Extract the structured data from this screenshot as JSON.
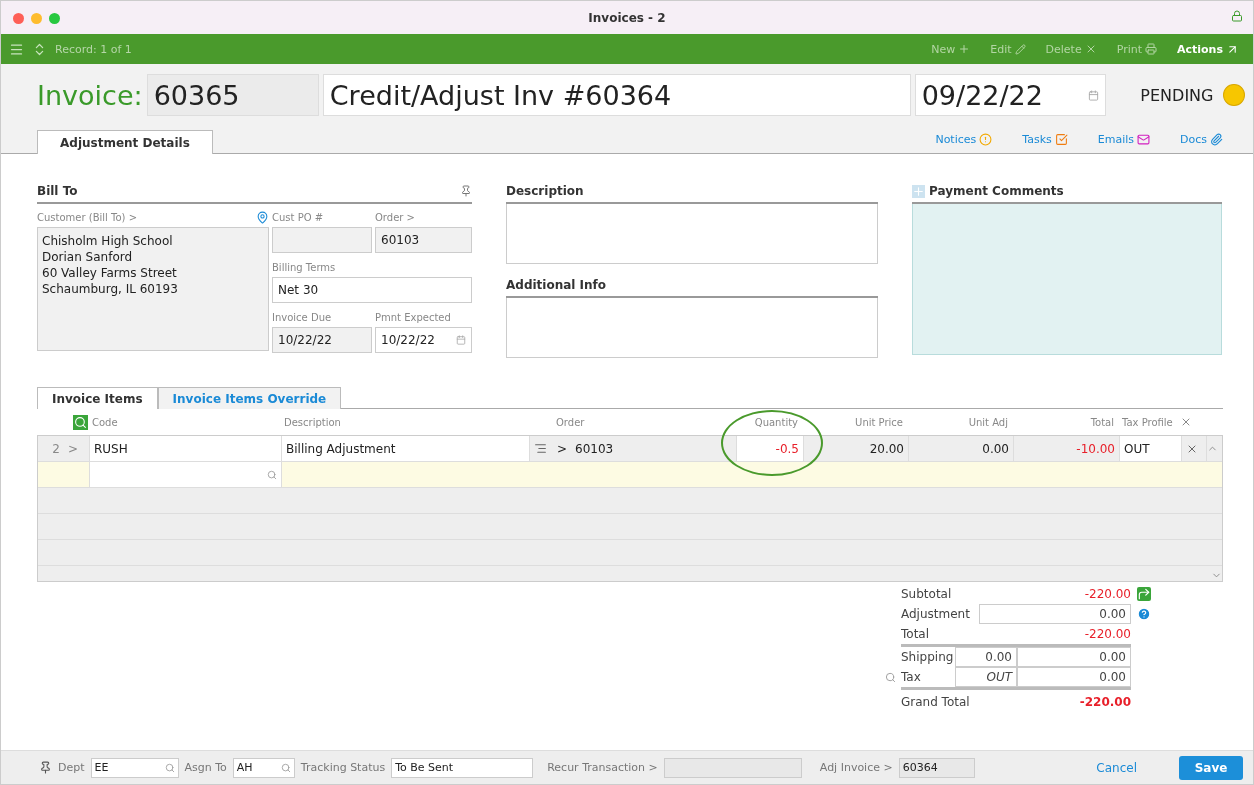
{
  "window": {
    "title": "Invoices - 2"
  },
  "toolbar": {
    "record": "Record: 1 of 1",
    "actions": [
      {
        "kind": "new",
        "label": "New",
        "disabled": true
      },
      {
        "kind": "edit",
        "label": "Edit",
        "disabled": true
      },
      {
        "kind": "delete",
        "label": "Delete",
        "disabled": true
      },
      {
        "kind": "print",
        "label": "Print",
        "disabled": true
      },
      {
        "kind": "actions",
        "label": "Actions",
        "disabled": false
      }
    ]
  },
  "header": {
    "label": "Invoice:",
    "number": "60365",
    "description": "Credit/Adjust Inv #60364",
    "date": "09/22/22",
    "status": "PENDING"
  },
  "tabs": [
    {
      "label": "Adjustment Details",
      "selected": true
    }
  ],
  "links": [
    {
      "kind": "notices",
      "label": "Notices"
    },
    {
      "kind": "tasks",
      "label": "Tasks"
    },
    {
      "kind": "emails",
      "label": "Emails"
    },
    {
      "kind": "docs",
      "label": "Docs"
    }
  ],
  "bill_to": {
    "heading": "Bill To",
    "customer_label": "Customer (Bill To) >",
    "address": [
      "Chisholm High School",
      "Dorian Sanford",
      "60 Valley Farms Street",
      "Schaumburg, IL 60193"
    ],
    "cust_po_label": "Cust PO #",
    "order_label": "Order >",
    "order": "60103",
    "billing_terms_label": "Billing Terms",
    "billing_terms": "Net 30",
    "invoice_due_label": "Invoice Due",
    "invoice_due": "10/22/22",
    "pmnt_expected_label": "Pmnt Expected",
    "pmnt_expected": "10/22/22"
  },
  "description": {
    "heading": "Description"
  },
  "additional_info": {
    "heading": "Additional Info"
  },
  "payment_comments": {
    "heading": "Payment Comments"
  },
  "item_tabs": [
    {
      "label": "Invoice Items",
      "selected": true
    },
    {
      "label": "Invoice Items Override",
      "selected": false
    }
  ],
  "table": {
    "columns": [
      {
        "label": "Code",
        "circled": false
      },
      {
        "label": "Description",
        "circled": false
      },
      {
        "label": "Order",
        "circled": false
      },
      {
        "label": "Quantity",
        "circled": true
      },
      {
        "label": "Unit Price",
        "circled": false
      },
      {
        "label": "Unit Adj",
        "circled": false
      },
      {
        "label": "Total",
        "circled": false
      },
      {
        "label": "Tax Profile",
        "circled": false
      }
    ],
    "rows": [
      {
        "line": "2",
        "arrow": ">",
        "code": "RUSH",
        "description": "Billing Adjustment",
        "order_arrow": ">",
        "order": "60103",
        "quantity": "-0.5",
        "unit_price": "20.00",
        "unit_adj": "0.00",
        "total": "-10.00",
        "tax_profile": "OUT"
      }
    ]
  },
  "totals": {
    "subtotal_label": "Subtotal",
    "subtotal": "-220.00",
    "adjustment_label": "Adjustment",
    "adjustment": "0.00",
    "total_label": "Total",
    "total": "-220.00",
    "shipping_label": "Shipping",
    "shipping_rate": "0.00",
    "shipping": "0.00",
    "tax_label": "Tax",
    "tax_profile": "OUT",
    "tax": "0.00",
    "grand_total_label": "Grand Total",
    "grand_total": "-220.00"
  },
  "footer": {
    "dept_label": "Dept",
    "dept": "EE",
    "asgn_label": "Asgn To",
    "asgn": "AH",
    "tracking_label": "Tracking Status",
    "tracking": "To Be Sent",
    "recur_label": "Recur Transaction >",
    "adj_invoice_label": "Adj Invoice >",
    "adj_invoice": "60364",
    "cancel": "Cancel",
    "save": "Save"
  }
}
